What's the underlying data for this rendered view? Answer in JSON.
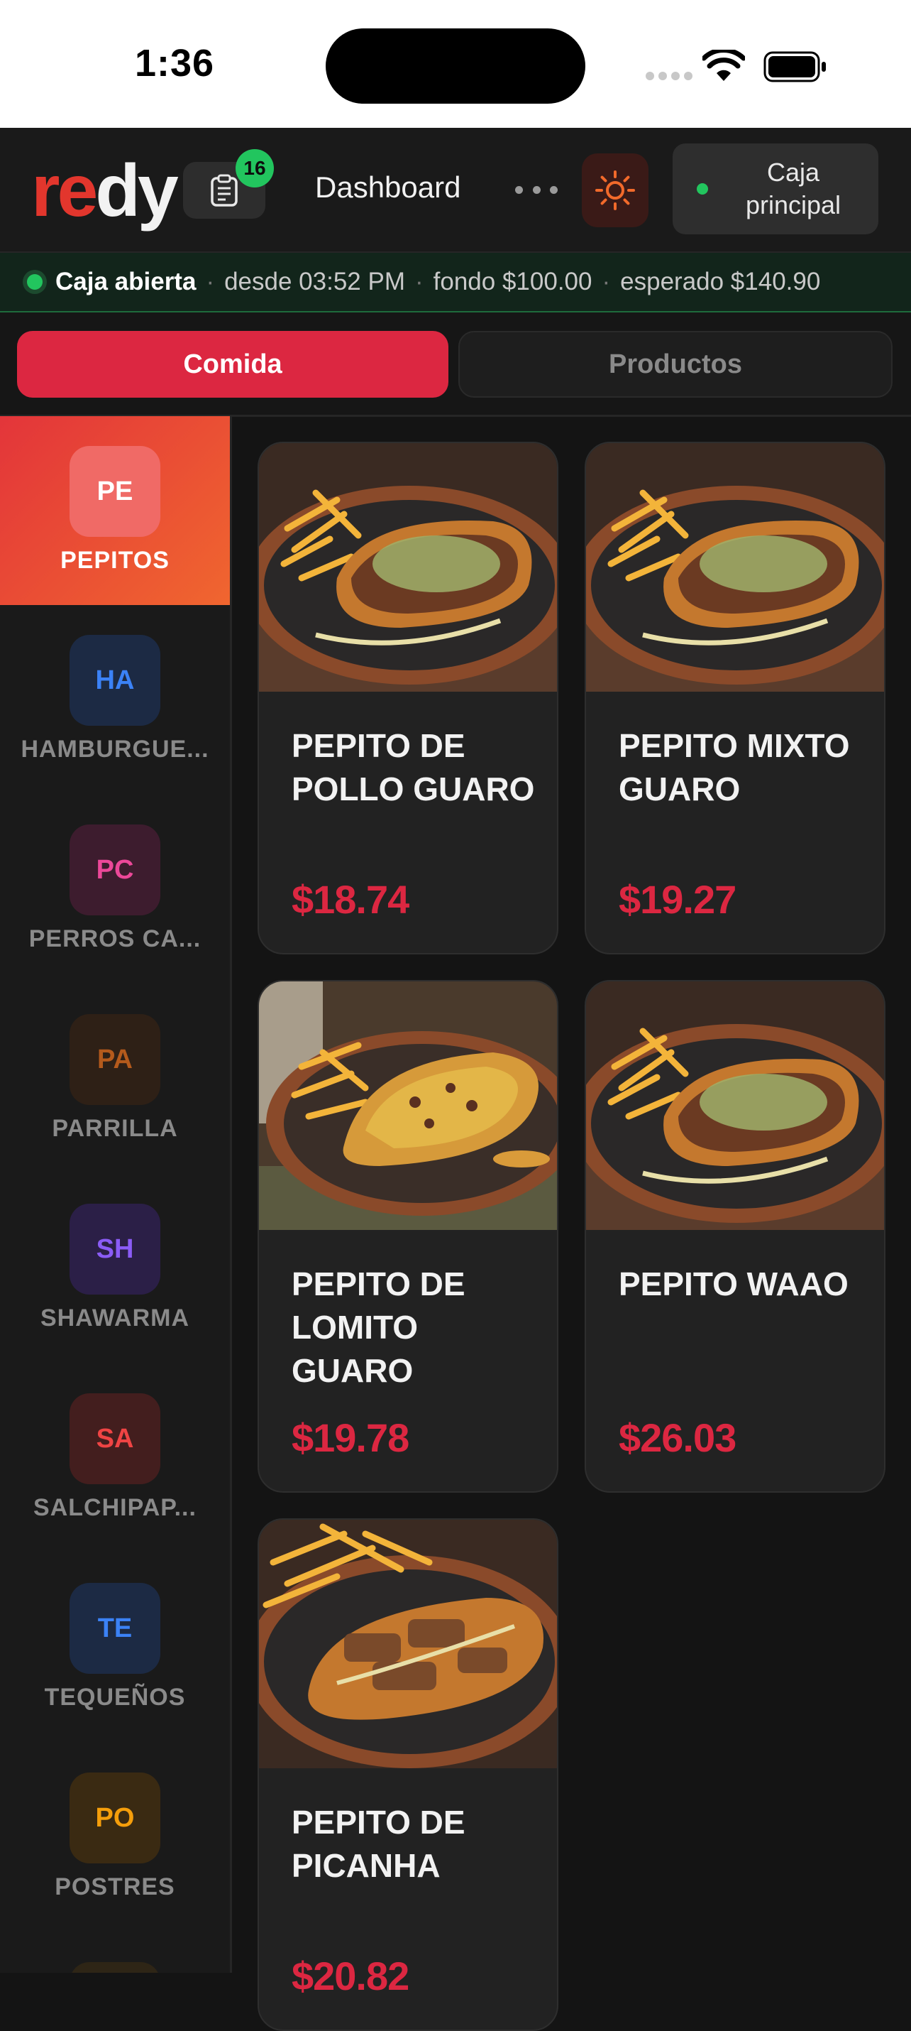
{
  "status_bar": {
    "time": "1:36"
  },
  "header": {
    "logo": {
      "part1": "re",
      "part2": "dy"
    },
    "orders_count": "16",
    "title": "Dashboard",
    "register_button": "Caja principal"
  },
  "cash_status": {
    "status": "Caja abierta",
    "since": "desde 03:52 PM",
    "fund": "fondo $100.00",
    "expected": "esperado $140.90",
    "separator": "·"
  },
  "tabs": [
    {
      "label": "Comida",
      "active": true
    },
    {
      "label": "Productos",
      "active": false
    }
  ],
  "categories": [
    {
      "abbr": "PE",
      "label": "PEPITOS",
      "active": true,
      "color": "#ffffff",
      "bg": "#f06a66"
    },
    {
      "abbr": "HA",
      "label": "HAMBURGUE...",
      "color": "#3b82f6",
      "bg": "#1c2a44"
    },
    {
      "abbr": "PC",
      "label": "PERROS CA...",
      "color": "#ec4899",
      "bg": "#3d1c2e"
    },
    {
      "abbr": "PA",
      "label": "PARRILLA",
      "color": "#b45a1c",
      "bg": "#2e2016"
    },
    {
      "abbr": "SH",
      "label": "SHAWARMA",
      "color": "#8b5cf6",
      "bg": "#2b1f47"
    },
    {
      "abbr": "SA",
      "label": "SALCHIPAP...",
      "color": "#ef4444",
      "bg": "#431e1e"
    },
    {
      "abbr": "TE",
      "label": "TEQUEÑOS",
      "color": "#3b82f6",
      "bg": "#1c2a44"
    },
    {
      "abbr": "PO",
      "label": "POSTRES",
      "color": "#f59e0b",
      "bg": "#3a2a12"
    }
  ],
  "products": [
    {
      "name": "PEPITO DE POLLO GUARO",
      "price": "$18.74"
    },
    {
      "name": "PEPITO MIXTO GUARO",
      "price": "$19.27"
    },
    {
      "name": "PEPITO DE LOMITO GUARO",
      "price": "$19.78"
    },
    {
      "name": "PEPITO WAAO",
      "price": "$26.03"
    },
    {
      "name": "PEPITO DE PICANHA",
      "price": "$20.82"
    }
  ],
  "colors": {
    "accent": "#dc2741",
    "brand_orange": "#f26a2b",
    "open_green": "#22c55e"
  }
}
